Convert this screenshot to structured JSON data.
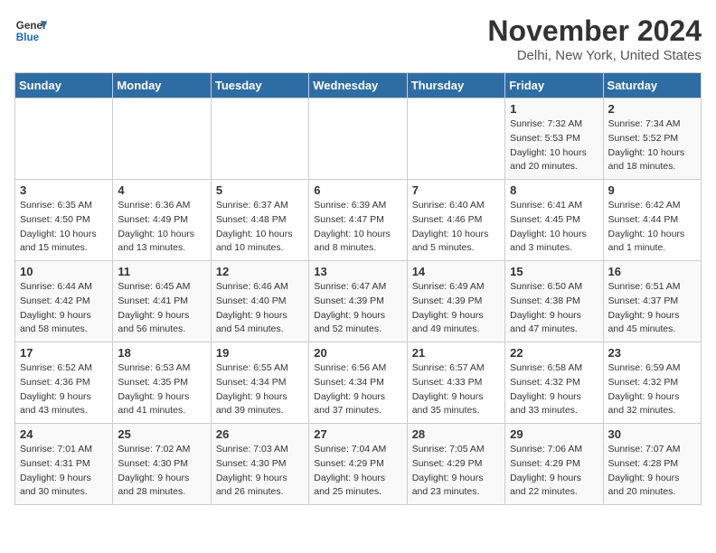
{
  "logo": {
    "line1": "General",
    "line2": "Blue"
  },
  "title": "November 2024",
  "location": "Delhi, New York, United States",
  "days_of_week": [
    "Sunday",
    "Monday",
    "Tuesday",
    "Wednesday",
    "Thursday",
    "Friday",
    "Saturday"
  ],
  "weeks": [
    [
      {
        "day": "",
        "info": ""
      },
      {
        "day": "",
        "info": ""
      },
      {
        "day": "",
        "info": ""
      },
      {
        "day": "",
        "info": ""
      },
      {
        "day": "",
        "info": ""
      },
      {
        "day": "1",
        "info": "Sunrise: 7:32 AM\nSunset: 5:53 PM\nDaylight: 10 hours\nand 20 minutes."
      },
      {
        "day": "2",
        "info": "Sunrise: 7:34 AM\nSunset: 5:52 PM\nDaylight: 10 hours\nand 18 minutes."
      }
    ],
    [
      {
        "day": "3",
        "info": "Sunrise: 6:35 AM\nSunset: 4:50 PM\nDaylight: 10 hours\nand 15 minutes."
      },
      {
        "day": "4",
        "info": "Sunrise: 6:36 AM\nSunset: 4:49 PM\nDaylight: 10 hours\nand 13 minutes."
      },
      {
        "day": "5",
        "info": "Sunrise: 6:37 AM\nSunset: 4:48 PM\nDaylight: 10 hours\nand 10 minutes."
      },
      {
        "day": "6",
        "info": "Sunrise: 6:39 AM\nSunset: 4:47 PM\nDaylight: 10 hours\nand 8 minutes."
      },
      {
        "day": "7",
        "info": "Sunrise: 6:40 AM\nSunset: 4:46 PM\nDaylight: 10 hours\nand 5 minutes."
      },
      {
        "day": "8",
        "info": "Sunrise: 6:41 AM\nSunset: 4:45 PM\nDaylight: 10 hours\nand 3 minutes."
      },
      {
        "day": "9",
        "info": "Sunrise: 6:42 AM\nSunset: 4:44 PM\nDaylight: 10 hours\nand 1 minute."
      }
    ],
    [
      {
        "day": "10",
        "info": "Sunrise: 6:44 AM\nSunset: 4:42 PM\nDaylight: 9 hours\nand 58 minutes."
      },
      {
        "day": "11",
        "info": "Sunrise: 6:45 AM\nSunset: 4:41 PM\nDaylight: 9 hours\nand 56 minutes."
      },
      {
        "day": "12",
        "info": "Sunrise: 6:46 AM\nSunset: 4:40 PM\nDaylight: 9 hours\nand 54 minutes."
      },
      {
        "day": "13",
        "info": "Sunrise: 6:47 AM\nSunset: 4:39 PM\nDaylight: 9 hours\nand 52 minutes."
      },
      {
        "day": "14",
        "info": "Sunrise: 6:49 AM\nSunset: 4:39 PM\nDaylight: 9 hours\nand 49 minutes."
      },
      {
        "day": "15",
        "info": "Sunrise: 6:50 AM\nSunset: 4:38 PM\nDaylight: 9 hours\nand 47 minutes."
      },
      {
        "day": "16",
        "info": "Sunrise: 6:51 AM\nSunset: 4:37 PM\nDaylight: 9 hours\nand 45 minutes."
      }
    ],
    [
      {
        "day": "17",
        "info": "Sunrise: 6:52 AM\nSunset: 4:36 PM\nDaylight: 9 hours\nand 43 minutes."
      },
      {
        "day": "18",
        "info": "Sunrise: 6:53 AM\nSunset: 4:35 PM\nDaylight: 9 hours\nand 41 minutes."
      },
      {
        "day": "19",
        "info": "Sunrise: 6:55 AM\nSunset: 4:34 PM\nDaylight: 9 hours\nand 39 minutes."
      },
      {
        "day": "20",
        "info": "Sunrise: 6:56 AM\nSunset: 4:34 PM\nDaylight: 9 hours\nand 37 minutes."
      },
      {
        "day": "21",
        "info": "Sunrise: 6:57 AM\nSunset: 4:33 PM\nDaylight: 9 hours\nand 35 minutes."
      },
      {
        "day": "22",
        "info": "Sunrise: 6:58 AM\nSunset: 4:32 PM\nDaylight: 9 hours\nand 33 minutes."
      },
      {
        "day": "23",
        "info": "Sunrise: 6:59 AM\nSunset: 4:32 PM\nDaylight: 9 hours\nand 32 minutes."
      }
    ],
    [
      {
        "day": "24",
        "info": "Sunrise: 7:01 AM\nSunset: 4:31 PM\nDaylight: 9 hours\nand 30 minutes."
      },
      {
        "day": "25",
        "info": "Sunrise: 7:02 AM\nSunset: 4:30 PM\nDaylight: 9 hours\nand 28 minutes."
      },
      {
        "day": "26",
        "info": "Sunrise: 7:03 AM\nSunset: 4:30 PM\nDaylight: 9 hours\nand 26 minutes."
      },
      {
        "day": "27",
        "info": "Sunrise: 7:04 AM\nSunset: 4:29 PM\nDaylight: 9 hours\nand 25 minutes."
      },
      {
        "day": "28",
        "info": "Sunrise: 7:05 AM\nSunset: 4:29 PM\nDaylight: 9 hours\nand 23 minutes."
      },
      {
        "day": "29",
        "info": "Sunrise: 7:06 AM\nSunset: 4:29 PM\nDaylight: 9 hours\nand 22 minutes."
      },
      {
        "day": "30",
        "info": "Sunrise: 7:07 AM\nSunset: 4:28 PM\nDaylight: 9 hours\nand 20 minutes."
      }
    ]
  ]
}
